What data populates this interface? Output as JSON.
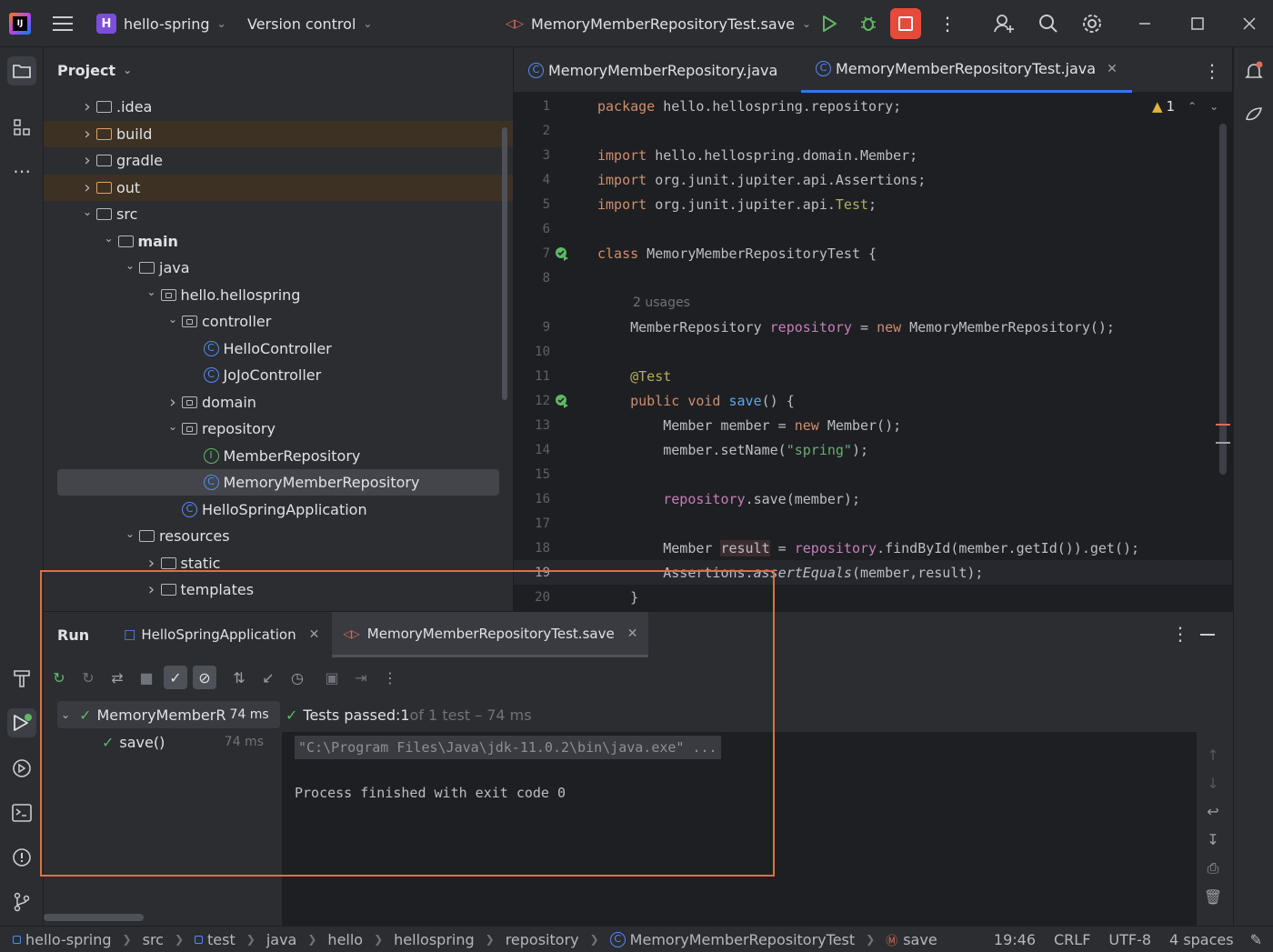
{
  "titlebar": {
    "project_badge": "H",
    "project_name": "hello-spring",
    "vcs": "Version control",
    "run_config": "MemoryMemberRepositoryTest.save",
    "icons": [
      "main-menu-icon",
      "run-icon",
      "debug-icon",
      "stop-icon",
      "more-icon",
      "add-user-icon",
      "search-icon",
      "settings-icon",
      "minimize-icon",
      "maximize-icon",
      "close-icon"
    ]
  },
  "project": {
    "title": "Project",
    "tree": [
      {
        "label": ".idea",
        "depth": 0,
        "type": "folder",
        "expanded": false
      },
      {
        "label": "build",
        "depth": 0,
        "type": "folder-orange",
        "expanded": false
      },
      {
        "label": "gradle",
        "depth": 0,
        "type": "folder",
        "expanded": false
      },
      {
        "label": "out",
        "depth": 0,
        "type": "folder-orange",
        "expanded": false
      },
      {
        "label": "src",
        "depth": 0,
        "type": "folder",
        "expanded": true
      },
      {
        "label": "main",
        "depth": 1,
        "type": "folder",
        "expanded": true
      },
      {
        "label": "java",
        "depth": 2,
        "type": "folder",
        "expanded": true
      },
      {
        "label": "hello.hellospring",
        "depth": 3,
        "type": "package",
        "expanded": true
      },
      {
        "label": "controller",
        "depth": 4,
        "type": "package",
        "expanded": true
      },
      {
        "label": "HelloController",
        "depth": 5,
        "type": "class"
      },
      {
        "label": "JoJoController",
        "depth": 5,
        "type": "class"
      },
      {
        "label": "domain",
        "depth": 4,
        "type": "package",
        "expanded": false
      },
      {
        "label": "repository",
        "depth": 4,
        "type": "package",
        "expanded": true
      },
      {
        "label": "MemberRepository",
        "depth": 5,
        "type": "interface"
      },
      {
        "label": "MemoryMemberRepository",
        "depth": 5,
        "type": "class",
        "selected": true
      },
      {
        "label": "HelloSpringApplication",
        "depth": 4,
        "type": "class"
      },
      {
        "label": "resources",
        "depth": 2,
        "type": "folder",
        "expanded": true
      },
      {
        "label": "static",
        "depth": 3,
        "type": "folder",
        "expanded": false
      },
      {
        "label": "templates",
        "depth": 3,
        "type": "folder",
        "expanded": false
      }
    ]
  },
  "editor": {
    "tabs": [
      {
        "label": "MemoryMemberRepository.java"
      },
      {
        "label": "MemoryMemberRepositoryTest.java",
        "active": true
      }
    ],
    "warning_count": "1",
    "usages_hint": "2 usages",
    "line_numbers": [
      "1",
      "2",
      "3",
      "4",
      "5",
      "6",
      "7",
      "8",
      "9",
      "10",
      "11",
      "12",
      "13",
      "14",
      "15",
      "16",
      "17",
      "18",
      "19",
      "20"
    ],
    "lines": {
      "l1_kw": "package",
      "l1_rest": " hello.hellospring.repository;",
      "l3_kw": "import",
      "l3_rest": " hello.hellospring.domain.Member;",
      "l4_kw": "import",
      "l4_rest": " org.junit.jupiter.api.Assertions;",
      "l5_kw": "import",
      "l5_rest": " org.junit.jupiter.api.",
      "l5_tail": "Test",
      "l5_end": ";",
      "l7_kw": "class",
      "l7_rest": " MemoryMemberRepositoryTest {",
      "l9_a": "    MemberRepository ",
      "l9_fld": "repository",
      "l9_b": " = ",
      "l9_kw": "new",
      "l9_c": " MemoryMemberRepository();",
      "l11": "    @Test",
      "l12_kw": "    public void ",
      "l12_fn": "save",
      "l12_rest": "() {",
      "l13_a": "        Member member = ",
      "l13_kw": "new",
      "l13_b": " Member();",
      "l14_a": "        member.setName(",
      "l14_str": "\"spring\"",
      "l14_b": ");",
      "l16_fld": "        repository",
      "l16_b": ".save(member);",
      "l18_a": "        Member ",
      "l18_b": "result",
      "l18_c": " = ",
      "l18_fld": "repository",
      "l18_d": ".findById(member.getId()).get();",
      "l19_a": "        Assertions.",
      "l19_it": "assertEquals",
      "l19_b": "(member,result);",
      "l20": "    }"
    }
  },
  "run": {
    "title": "Run",
    "tabs": [
      {
        "label": "HelloSpringApplication"
      },
      {
        "label": "MemoryMemberRepositoryTest.save",
        "active": true
      }
    ],
    "test_root": "MemoryMemberR",
    "test_root_time": "74 ms",
    "test_child": "save()",
    "test_child_time": "74 ms",
    "summary_prefix": "Tests passed: ",
    "summary_count": "1",
    "summary_suffix": " of 1 test – 74 ms",
    "console_cmd": "\"C:\\Program Files\\Java\\jdk-11.0.2\\bin\\java.exe\" ...",
    "console_exit": "Process finished with exit code 0"
  },
  "statusbar": {
    "crumbs": [
      "hello-spring",
      "src",
      "test",
      "java",
      "hello",
      "hellospring",
      "repository",
      "MemoryMemberRepositoryTest",
      "save"
    ],
    "position": "19:46",
    "line_sep": "CRLF",
    "encoding": "UTF-8",
    "indent": "4 spaces"
  },
  "colors": {
    "accent": "#3574f0",
    "stop": "#e64a3b",
    "success": "#5fb865",
    "highlight_box": "#d9704d"
  }
}
